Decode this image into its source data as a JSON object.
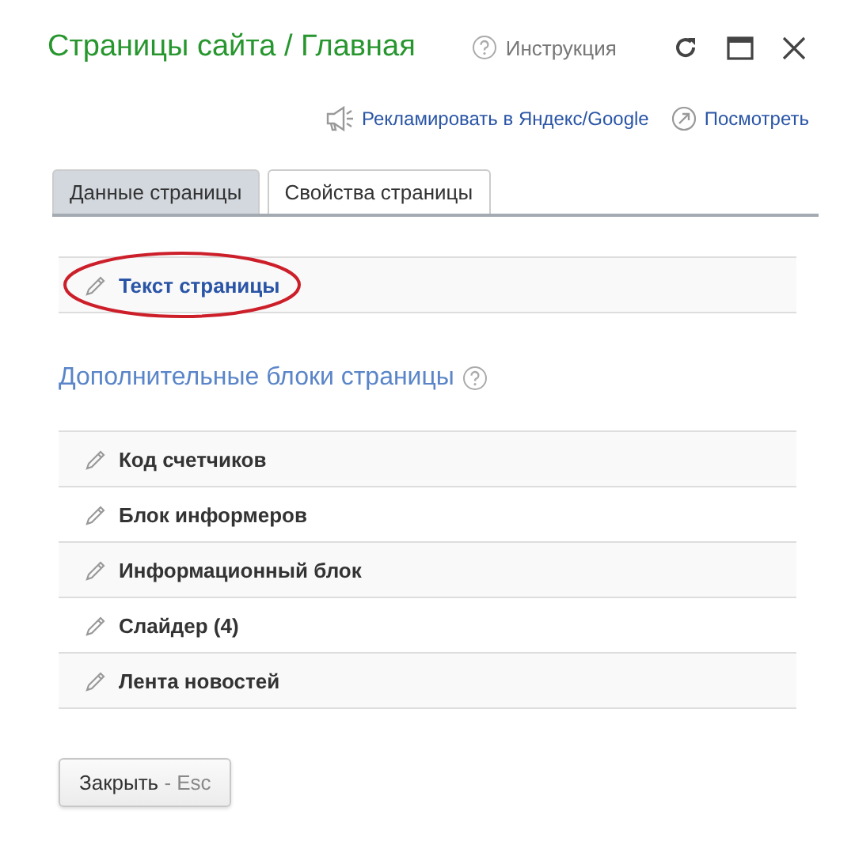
{
  "window": {
    "title": "Страницы сайта / Главная",
    "help_link": "Инструкция"
  },
  "actions": [
    {
      "kind": "advertise",
      "label": "Рекламировать в Яндекс/Google"
    },
    {
      "kind": "view",
      "label": "Посмотреть"
    }
  ],
  "tabs": [
    {
      "label": "Данные страницы",
      "selected": true
    },
    {
      "label": "Свойства страницы",
      "selected": false
    }
  ],
  "main_block": {
    "label": "Текст страницы",
    "highlighted": true
  },
  "extra_blocks": {
    "heading": "Дополнительные блоки страницы",
    "items": [
      {
        "label": "Код счетчиков"
      },
      {
        "label": "Блок информеров"
      },
      {
        "label": "Информационный блок"
      },
      {
        "label": "Слайдер (4)"
      },
      {
        "label": "Лента новостей"
      }
    ]
  },
  "close_button": {
    "label": "Закрыть",
    "shortcut": "- Esc"
  }
}
